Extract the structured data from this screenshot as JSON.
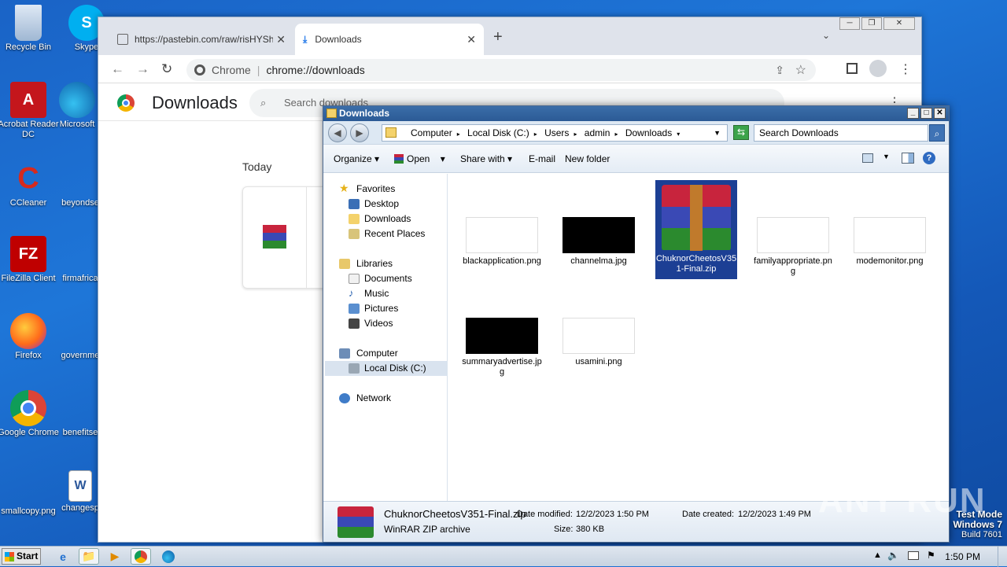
{
  "desktop": {
    "icons_left": [
      "Recycle Bin",
      "Acrobat Reader DC",
      "CCleaner",
      "FileZilla Client",
      "Firefox",
      "Google Chrome",
      "smallcopy.png"
    ],
    "icons_right": [
      "Skype",
      "Microsoft",
      "beyondse",
      "firmafrica",
      "governme",
      "benefitse",
      "changesp"
    ]
  },
  "chrome": {
    "tab1": "https://pastebin.com/raw/risHYShF",
    "tab2": "Downloads",
    "omni_site": "Chrome",
    "omni_url": "chrome://downloads",
    "page_title": "Downloads",
    "search_placeholder": "Search downloads",
    "section": "Today"
  },
  "explorer": {
    "title": "Downloads",
    "crumbs": [
      "Computer",
      "Local Disk (C:)",
      "Users",
      "admin",
      "Downloads"
    ],
    "search_placeholder": "Search Downloads",
    "commands": [
      "Organize",
      "Open",
      "Share with",
      "E-mail",
      "New folder"
    ],
    "nav": {
      "favorites": "Favorites",
      "fav_items": [
        "Desktop",
        "Downloads",
        "Recent Places"
      ],
      "libraries": "Libraries",
      "lib_items": [
        "Documents",
        "Music",
        "Pictures",
        "Videos"
      ],
      "computer": "Computer",
      "local_disk": "Local Disk (C:)",
      "network": "Network"
    },
    "files": [
      "blackapplication.png",
      "channelma.jpg",
      "ChuknorCheetosV351-Final.zip",
      "familyappropriate.png",
      "modemonitor.png",
      "summaryadvertise.jpg",
      "usamini.png"
    ],
    "details": {
      "name": "ChuknorCheetosV351-Final.zip",
      "type": "WinRAR ZIP archive",
      "modified_label": "Date modified:",
      "modified": "12/2/2023 1:50 PM",
      "size_label": "Size:",
      "size": "380 KB",
      "created_label": "Date created:",
      "created": "12/2/2023 1:49 PM"
    }
  },
  "taskbar": {
    "start": "Start",
    "clock": "1:50 PM"
  },
  "watermark": {
    "line1": "Test Mode",
    "line2": "Windows 7",
    "line3": "Build 7601",
    "brand": "ANY RUN"
  }
}
